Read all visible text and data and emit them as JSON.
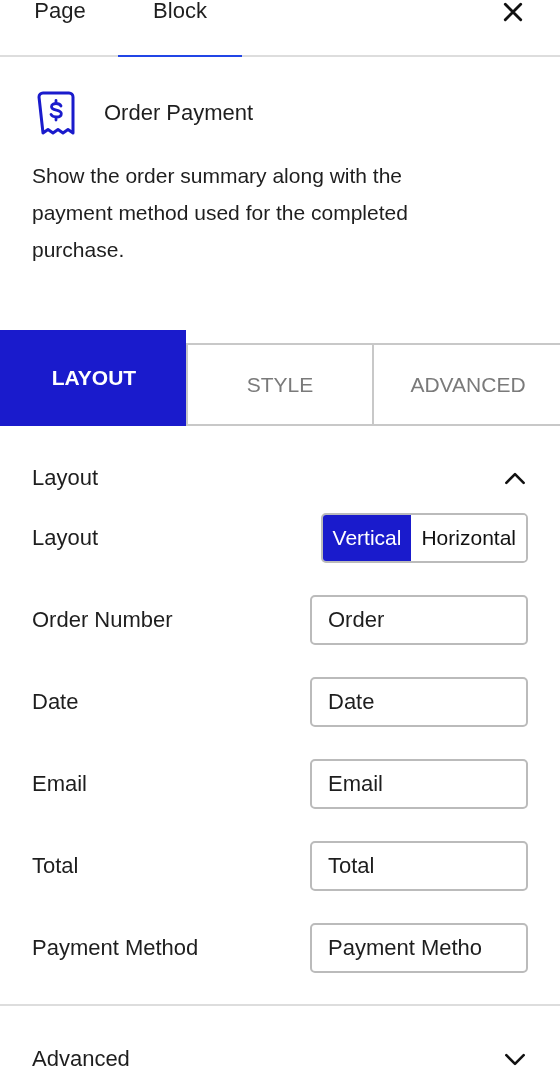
{
  "header_tabs": [
    {
      "label": "Page",
      "selected": false
    },
    {
      "label": "Block",
      "selected": true
    }
  ],
  "block": {
    "title": "Order Payment",
    "description": "Show the order summary along with the payment method used for the completed purchase."
  },
  "settings_tabs": [
    {
      "label": "LAYOUT",
      "selected": true
    },
    {
      "label": "STYLE",
      "selected": false
    },
    {
      "label": "ADVANCED",
      "selected": false
    }
  ],
  "panels": [
    {
      "title": "Layout",
      "expanded": true,
      "rows": [
        {
          "kind": "toggle",
          "label": "Layout",
          "options": [
            {
              "label": "Vertical",
              "selected": true
            },
            {
              "label": "Horizontal",
              "selected": false
            }
          ]
        },
        {
          "kind": "text",
          "label": "Order Number",
          "value": "Order"
        },
        {
          "kind": "text",
          "label": "Date",
          "value": "Date"
        },
        {
          "kind": "text",
          "label": "Email",
          "value": "Email"
        },
        {
          "kind": "text",
          "label": "Total",
          "value": "Total"
        },
        {
          "kind": "text",
          "label": "Payment Method",
          "value": "Payment Metho"
        }
      ]
    },
    {
      "title": "Advanced",
      "expanded": false
    }
  ]
}
